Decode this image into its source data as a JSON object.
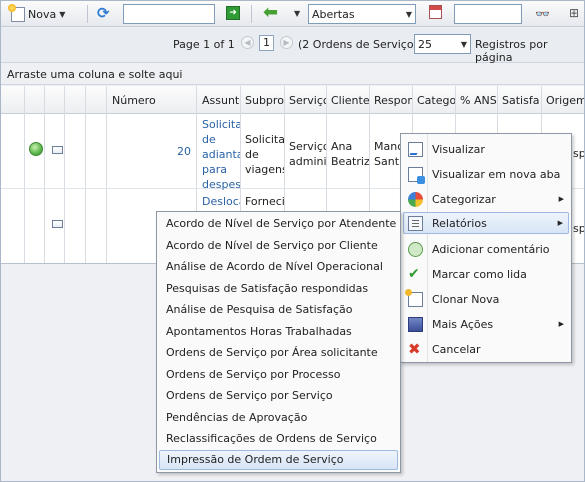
{
  "toolbar": {
    "new_label": "Nova",
    "status_select": "Abertas"
  },
  "pager": {
    "page_info": "Page 1 of 1",
    "current_page": "1",
    "count_text": "(2 Ordens de Serviço)",
    "page_size": "25",
    "page_size_label": "Registros por página"
  },
  "group_hint": "Arraste uma coluna e solte aqui",
  "grid": {
    "headers": [
      "Número",
      "Assunto",
      "Subpro",
      "Serviço",
      "Cliente",
      "Respon",
      "Catego",
      "% ANS",
      "Satisfa",
      "Origem"
    ],
    "rows": [
      {
        "numero": "20",
        "assunto": [
          "Solicita",
          "de",
          "adianta",
          "para",
          "despes"
        ],
        "subpro": [
          "Solicita",
          "de",
          "viagens"
        ],
        "servico": [
          "Serviço",
          "adminis"
        ],
        "cliente": [
          "Ana",
          "Beatriz"
        ],
        "respon": [
          "Manc",
          "Sant"
        ],
        "origem": "sp"
      },
      {
        "assunto": [
          "Desloca"
        ],
        "subpro": [
          "Forneci"
        ],
        "origem": "sp"
      }
    ]
  },
  "context_menu": {
    "items": [
      {
        "label": "Visualizar",
        "icon": "view-icon"
      },
      {
        "label": "Visualizar em nova aba",
        "icon": "view-new-tab-icon"
      },
      {
        "label": "Categorizar",
        "icon": "categorize-icon"
      },
      {
        "label": "Relatórios",
        "icon": "reports-icon"
      },
      {
        "label": "Adicionar comentário",
        "icon": "add-comment-icon"
      },
      {
        "label": "Marcar como lida",
        "icon": "check-icon"
      },
      {
        "label": "Clonar Nova",
        "icon": "clone-icon"
      },
      {
        "label": "Mais Ações",
        "icon": "more-actions-icon"
      },
      {
        "label": "Cancelar",
        "icon": "cancel-icon"
      }
    ]
  },
  "reports_submenu": {
    "items": [
      "Acordo de Nível de Serviço por Atendente",
      "Acordo de Nível de Serviço por Cliente",
      "Análise de Acordo de Nível Operacional",
      "Pesquisas de Satisfação respondidas",
      "Análise de Pesquisa de Satisfação",
      "Apontamentos Horas Trabalhadas",
      "Ordens de Serviço por Área solicitante",
      "Ordens de Serviço por Processo",
      "Ordens de Serviço por Serviço",
      "Pendências de Aprovação",
      "Reclassificações de Ordens de Serviço",
      "Impressão de Ordem de Serviço"
    ]
  },
  "colors": {
    "link": "#2a62a6",
    "highlight": "#d8e5f6",
    "status_ok": "#5ab54a"
  }
}
